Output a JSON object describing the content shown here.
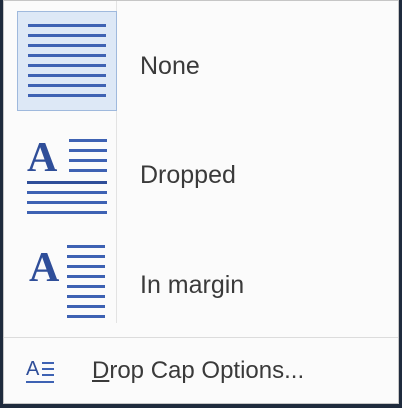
{
  "menu": {
    "items": [
      {
        "label": "None",
        "icon": "drop-cap-none-icon"
      },
      {
        "label": "Dropped",
        "icon": "drop-cap-dropped-icon"
      },
      {
        "label": "In margin",
        "icon": "drop-cap-in-margin-icon"
      }
    ],
    "options": {
      "label_accel": "D",
      "label_rest": "rop Cap Options...",
      "icon": "drop-cap-options-icon"
    },
    "icon_letter": "A",
    "colors": {
      "accent": "#3e62b3",
      "selected_bg": "#dde8f6",
      "selected_border": "#9fb9dd"
    }
  }
}
